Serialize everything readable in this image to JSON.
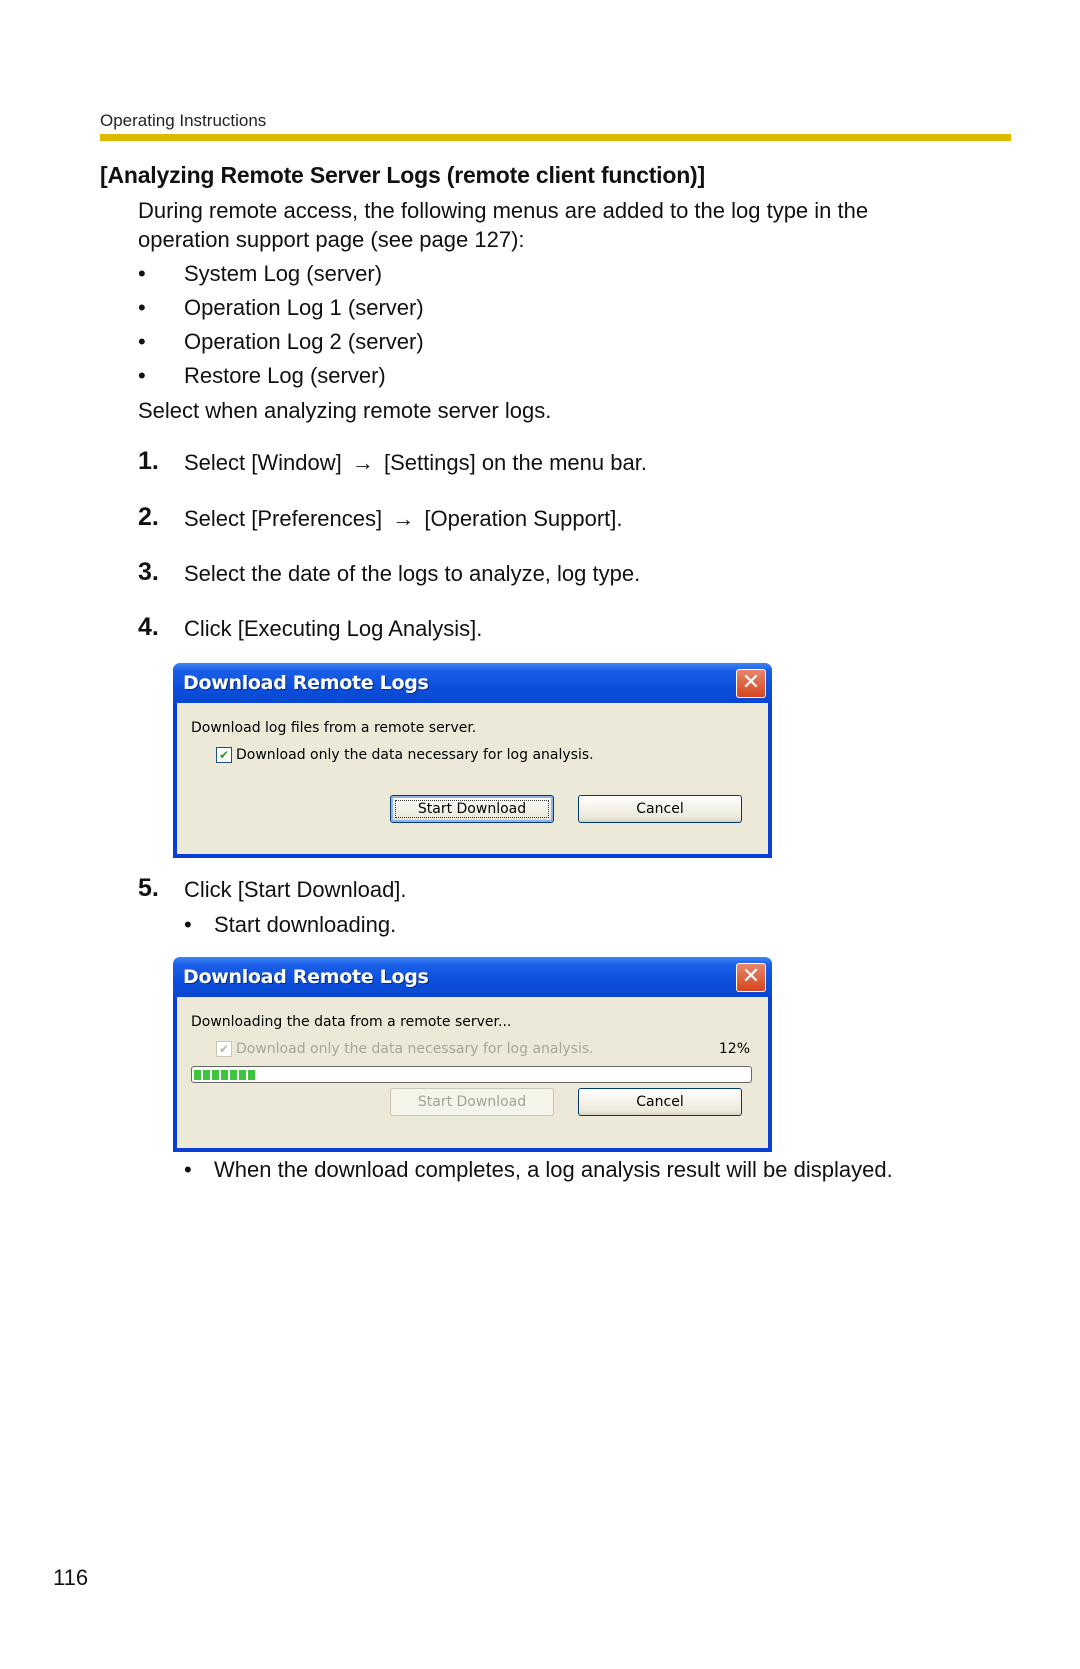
{
  "header": {
    "running_title": "Operating Instructions",
    "accent_color": "#dcb800"
  },
  "section": {
    "title": "[Analyzing Remote Server Logs (remote client function)]",
    "intro_lines": [
      "During remote access, the following menus are added to the log type in the",
      "operation support page (see page 127):"
    ],
    "bullets": [
      "System Log (server)",
      "Operation Log 1 (server)",
      "Operation Log 2 (server)",
      "Restore Log (server)"
    ],
    "bullet_glyph": "•",
    "after_note": "Select when analyzing remote server logs."
  },
  "steps": [
    {
      "num": "1.",
      "before": "Select [Window]",
      "arrow": "→",
      "after": "[Settings] on the menu bar."
    },
    {
      "num": "2.",
      "before": "Select [Preferences]",
      "arrow": "→",
      "after": "[Operation Support]."
    },
    {
      "num": "3.",
      "text": "Select the date of the logs to analyze, log type."
    },
    {
      "num": "4.",
      "text": "Click [Executing Log Analysis]."
    },
    {
      "num": "5.",
      "text": "Click [Start Download].",
      "sub": "Start downloading."
    }
  ],
  "dialog1": {
    "title": "Download Remote Logs",
    "close_glyph": "✕",
    "message": "Download log files from a remote server.",
    "checkbox_label": "Download only the data necessary for log analysis.",
    "checkbox_checked": true,
    "check_glyph": "✔",
    "start_button": "Start Download",
    "cancel_button": "Cancel"
  },
  "dialog2": {
    "title": "Download Remote Logs",
    "close_glyph": "✕",
    "message": "Downloading the data from a remote server...",
    "checkbox_label": "Download only the data necessary for log analysis.",
    "checkbox_checked": true,
    "checkbox_disabled": true,
    "check_glyph": "✔",
    "progress_percent_label": "12%",
    "progress_value": 0.12,
    "start_button": "Start Download",
    "start_button_disabled": true,
    "cancel_button": "Cancel"
  },
  "final_note": "When the download completes, a log analysis result will be displayed.",
  "page_number": "116"
}
